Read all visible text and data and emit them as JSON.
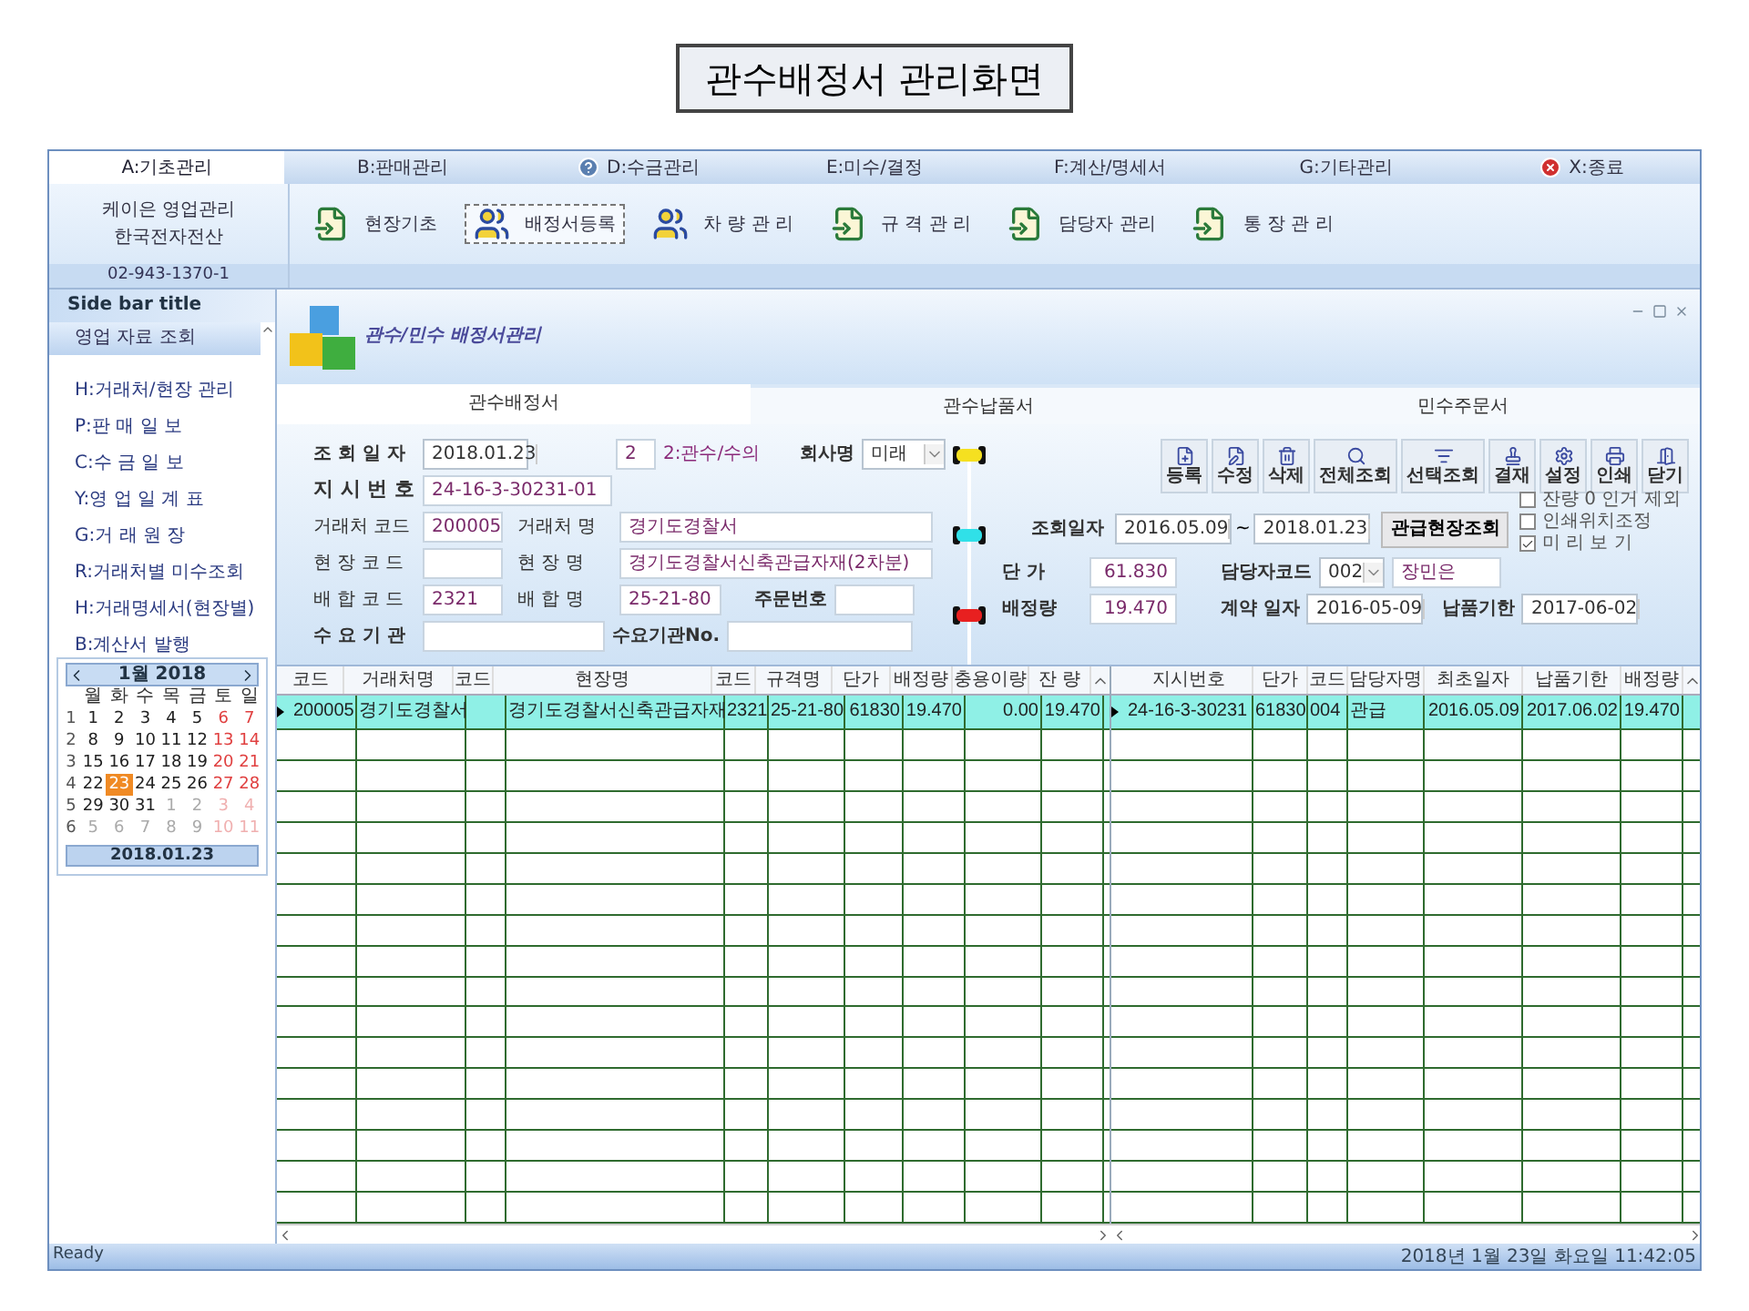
{
  "page_title": "관수배정서 관리화면",
  "menu": [
    {
      "label": "A:기초관리",
      "selected": true,
      "kind": "plain"
    },
    {
      "label": "B:판매관리",
      "selected": false,
      "kind": "plain"
    },
    {
      "label": "D:수금관리",
      "selected": false,
      "kind": "info"
    },
    {
      "label": "E:미수/결정",
      "selected": false,
      "kind": "plain"
    },
    {
      "label": "F:계산/명세서",
      "selected": false,
      "kind": "plain"
    },
    {
      "label": "G:기타관리",
      "selected": false,
      "kind": "plain"
    },
    {
      "label": "X:종료",
      "selected": false,
      "kind": "exit"
    }
  ],
  "company": {
    "name": "케이은 영업관리",
    "sub": "한국전자전산",
    "phone": "02-943-1370-1"
  },
  "ribbon": [
    {
      "label": "현장기초",
      "kind": "doc",
      "selected": false
    },
    {
      "label": "배정서등록",
      "kind": "people",
      "selected": true
    },
    {
      "label": "차 량 관 리",
      "kind": "people",
      "selected": false
    },
    {
      "label": "규 격 관 리",
      "kind": "doc",
      "selected": false
    },
    {
      "label": "담당자 관리",
      "kind": "doc",
      "selected": false
    },
    {
      "label": "통 장 관 리",
      "kind": "doc",
      "selected": false
    }
  ],
  "sidebar": {
    "title": "Side bar title",
    "group": "영업 자료 조회",
    "items": [
      "H:거래처/현장 관리",
      "P:판 매 일 보",
      "C:수 금 일 보",
      "Y:영 업 일 계 표",
      "G:거 래 원 장",
      "R:거래처별 미수조회",
      "H:거래명세서(현장별)",
      "B:계산서 발행"
    ]
  },
  "calendar": {
    "month": "1월 2018",
    "weekdays": [
      "월",
      "화",
      "수",
      "목",
      "금",
      "토",
      "일"
    ],
    "today": "2018.01.23",
    "weeks": [
      {
        "week": "1",
        "days": [
          {
            "d": "1",
            "weekend": false,
            "muted": false,
            "selected": false
          },
          {
            "d": "2",
            "weekend": false,
            "muted": false,
            "selected": false
          },
          {
            "d": "3",
            "weekend": false,
            "muted": false,
            "selected": false
          },
          {
            "d": "4",
            "weekend": false,
            "muted": false,
            "selected": false
          },
          {
            "d": "5",
            "weekend": false,
            "muted": false,
            "selected": false
          },
          {
            "d": "6",
            "weekend": true,
            "muted": false,
            "selected": false
          },
          {
            "d": "7",
            "weekend": true,
            "muted": false,
            "selected": false
          }
        ]
      },
      {
        "week": "2",
        "days": [
          {
            "d": "8",
            "weekend": false,
            "muted": false,
            "selected": false
          },
          {
            "d": "9",
            "weekend": false,
            "muted": false,
            "selected": false
          },
          {
            "d": "10",
            "weekend": false,
            "muted": false,
            "selected": false
          },
          {
            "d": "11",
            "weekend": false,
            "muted": false,
            "selected": false
          },
          {
            "d": "12",
            "weekend": false,
            "muted": false,
            "selected": false
          },
          {
            "d": "13",
            "weekend": true,
            "muted": false,
            "selected": false
          },
          {
            "d": "14",
            "weekend": true,
            "muted": false,
            "selected": false
          }
        ]
      },
      {
        "week": "3",
        "days": [
          {
            "d": "15",
            "weekend": false,
            "muted": false,
            "selected": false
          },
          {
            "d": "16",
            "weekend": false,
            "muted": false,
            "selected": false
          },
          {
            "d": "17",
            "weekend": false,
            "muted": false,
            "selected": false
          },
          {
            "d": "18",
            "weekend": false,
            "muted": false,
            "selected": false
          },
          {
            "d": "19",
            "weekend": false,
            "muted": false,
            "selected": false
          },
          {
            "d": "20",
            "weekend": true,
            "muted": false,
            "selected": false
          },
          {
            "d": "21",
            "weekend": true,
            "muted": false,
            "selected": false
          }
        ]
      },
      {
        "week": "4",
        "days": [
          {
            "d": "22",
            "weekend": false,
            "muted": false,
            "selected": false
          },
          {
            "d": "23",
            "weekend": false,
            "muted": false,
            "selected": true
          },
          {
            "d": "24",
            "weekend": false,
            "muted": false,
            "selected": false
          },
          {
            "d": "25",
            "weekend": false,
            "muted": false,
            "selected": false
          },
          {
            "d": "26",
            "weekend": false,
            "muted": false,
            "selected": false
          },
          {
            "d": "27",
            "weekend": true,
            "muted": false,
            "selected": false
          },
          {
            "d": "28",
            "weekend": true,
            "muted": false,
            "selected": false
          }
        ]
      },
      {
        "week": "5",
        "days": [
          {
            "d": "29",
            "weekend": false,
            "muted": false,
            "selected": false
          },
          {
            "d": "30",
            "weekend": false,
            "muted": false,
            "selected": false
          },
          {
            "d": "31",
            "weekend": false,
            "muted": false,
            "selected": false
          },
          {
            "d": "1",
            "weekend": false,
            "muted": true,
            "selected": false
          },
          {
            "d": "2",
            "weekend": false,
            "muted": true,
            "selected": false
          },
          {
            "d": "3",
            "weekend": true,
            "muted": true,
            "selected": false
          },
          {
            "d": "4",
            "weekend": true,
            "muted": true,
            "selected": false
          }
        ]
      },
      {
        "week": "6",
        "days": [
          {
            "d": "5",
            "weekend": false,
            "muted": true,
            "selected": false
          },
          {
            "d": "6",
            "weekend": false,
            "muted": true,
            "selected": false
          },
          {
            "d": "7",
            "weekend": false,
            "muted": true,
            "selected": false
          },
          {
            "d": "8",
            "weekend": false,
            "muted": true,
            "selected": false
          },
          {
            "d": "9",
            "weekend": false,
            "muted": true,
            "selected": false
          },
          {
            "d": "10",
            "weekend": true,
            "muted": true,
            "selected": false
          },
          {
            "d": "11",
            "weekend": true,
            "muted": true,
            "selected": false
          }
        ]
      }
    ]
  },
  "panel": {
    "title": "관수/민수 배정서관리"
  },
  "tabs": [
    {
      "label": "관수배정서",
      "selected": true
    },
    {
      "label": "관수납품서",
      "selected": false
    },
    {
      "label": "민수주문서",
      "selected": false
    }
  ],
  "form": {
    "date_label": "조 회 일 자",
    "date": "2018.01.23",
    "type_code": "2",
    "type_name": "2:관수/수의",
    "company_label": "회사명",
    "company": "미래",
    "order_label": "지 시 번 호",
    "order_no": "24-16-3-30231-01",
    "client_code_label": "거래처 코드",
    "client_code": "200005",
    "client_name_label": "거래처 명",
    "client_name": "경기도경찰서",
    "site_code_label": "현 장 코 드",
    "site_name_label": "현 장 명",
    "site_name": "경기도경찰서신축관급자재(2차분)",
    "mix_code_label": "배 합 코 드",
    "mix_code": "2321",
    "mix_name_label": "배 합 명",
    "mix_name": "25-21-80",
    "po_label": "주문번호",
    "agency_label": "수 요 기 관",
    "agency_no_label": "수요기관No.",
    "price_label": "단 가",
    "price": "61.830",
    "qty_label": "배정량",
    "qty": "19.470",
    "staff_code_label": "담당자코드",
    "staff_code": "002",
    "staff_name": "장민은",
    "contract_label": "계약 일자",
    "contract_date": "2016-05-09",
    "due_label": "납품기한",
    "due_date": "2017-06-02"
  },
  "toolbar": [
    "등록",
    "수정",
    "삭제",
    "전체조회",
    "선택조회",
    "결재",
    "설정",
    "인쇄",
    "닫기"
  ],
  "query": {
    "label": "조회일자",
    "from": "2016.05.09",
    "sep": "~",
    "to": "2018.01.23",
    "button": "관급현장조회"
  },
  "options": [
    {
      "label": "잔량 0 인거 제외",
      "checked": false
    },
    {
      "label": "인쇄위치조정",
      "checked": false
    },
    {
      "label": "미 리 보 기",
      "checked": true
    }
  ],
  "left_table": {
    "columns": [
      "코드",
      "거래처명",
      "코드",
      "현장명",
      "코드",
      "규격명",
      "단가",
      "배정량",
      "충용이량",
      "잔 량"
    ],
    "rows": [
      [
        "200005",
        "경기도경찰서",
        "",
        "경기도경찰서신축관급자재",
        "2321",
        "25-21-80",
        "61830",
        "19.470",
        "0.00",
        "19.470"
      ]
    ]
  },
  "right_table": {
    "columns": [
      "지시번호",
      "단가",
      "코드",
      "담당자명",
      "최초일자",
      "납품기한",
      "배정량"
    ],
    "rows": [
      [
        "24-16-3-30231",
        "61830",
        "004",
        "관급",
        "2016.05.09",
        "2017.06.02",
        "19.470"
      ]
    ]
  },
  "status_bar": {
    "left": "Ready",
    "right": "2018년 1월 23일 화요일 11:42:05"
  }
}
